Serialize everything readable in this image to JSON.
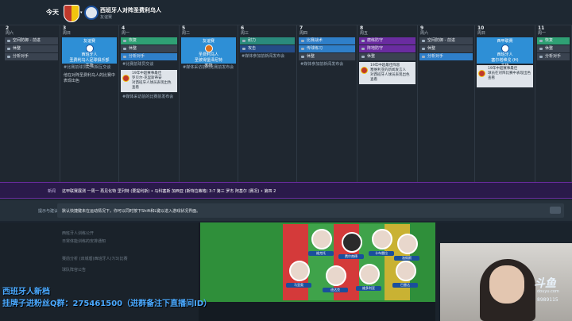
{
  "header": {
    "today": "今天",
    "match_title": "西班牙人对阵圣费利乌人",
    "match_subtitle": "友谊赛"
  },
  "calendar": {
    "days": [
      {
        "num": "2",
        "weekday": "周六",
        "items": [
          {
            "type": "bar",
            "style": "gray",
            "label": "空间防御 - 前进"
          },
          {
            "type": "bar",
            "style": "gray",
            "label": "休整"
          },
          {
            "type": "bar",
            "style": "gray",
            "label": "分析对手"
          }
        ]
      },
      {
        "num": "3",
        "weekday": "周日",
        "items": [
          {
            "type": "match",
            "style": "home",
            "lines": [
              "友谊赛",
              "西班牙人",
              "圣费利乌人足球俱乐部",
              "主场"
            ]
          },
          {
            "type": "note",
            "label": "#比赛前球员之间相互交谈"
          },
          {
            "type": "note",
            "label": "他在对阵圣费利乌人的比赛中表现出色",
            "light": true
          }
        ]
      },
      {
        "num": "4",
        "weekday": "周一",
        "items": [
          {
            "type": "bar",
            "style": "green",
            "label": "恢复"
          },
          {
            "type": "bar",
            "style": "gray",
            "label": "休整"
          },
          {
            "type": "bar",
            "style": "blue",
            "label": "分析对手"
          },
          {
            "type": "note",
            "label": "#比赛前球员交谈"
          },
          {
            "type": "event",
            "lines": [
              "19年中超赛事最佳",
              "罗贝尔-克里斯蒂安",
              "对西班牙人球员表现出色",
              "查看"
            ]
          },
          {
            "type": "note",
            "label": "#媒体采访前的比赛前发布会"
          }
        ]
      },
      {
        "num": "5",
        "weekday": "周二",
        "items": [
          {
            "type": "match",
            "style": "away",
            "lines": [
              "友谊赛",
              "圣费利乌人",
              "圣彼得堡泽尼特",
              "客场"
            ]
          },
          {
            "type": "note",
            "label": "#媒体采访前的比赛前发布会"
          }
        ]
      },
      {
        "num": "6",
        "weekday": "周三",
        "items": [
          {
            "type": "bar",
            "style": "teal",
            "label": "耐力"
          },
          {
            "type": "bar",
            "style": "dblue",
            "label": "攻击"
          },
          {
            "type": "note",
            "label": "#媒体参加前新闻发布会"
          }
        ]
      },
      {
        "num": "7",
        "weekday": "周四",
        "items": [
          {
            "type": "bar",
            "style": "blue",
            "label": "比赛战术"
          },
          {
            "type": "bar",
            "style": "blue",
            "label": "传球练习"
          },
          {
            "type": "bar",
            "style": "gray",
            "label": "休整"
          },
          {
            "type": "note",
            "label": "#媒体参加前新闻发布会"
          }
        ]
      },
      {
        "num": "8",
        "weekday": "周五",
        "items": [
          {
            "type": "bar",
            "style": "purple",
            "label": "磨练防守"
          },
          {
            "type": "bar",
            "style": "purple",
            "label": "阵地防守"
          },
          {
            "type": "bar",
            "style": "gray",
            "label": "休整"
          },
          {
            "type": "event",
            "lines": [
              "19年中超最佳阵容",
              "塞维利亚的新闻发言人",
              "对西班牙人球员表现出色",
              "查看"
            ]
          }
        ]
      },
      {
        "num": "9",
        "weekday": "周六",
        "items": [
          {
            "type": "bar",
            "style": "gray",
            "label": "空间防御 - 前进"
          },
          {
            "type": "bar",
            "style": "gray",
            "label": "休整"
          },
          {
            "type": "bar",
            "style": "blue",
            "label": "分析对手"
          }
        ]
      },
      {
        "num": "10",
        "weekday": "周日",
        "items": [
          {
            "type": "match",
            "style": "home",
            "lines": [
              "西甲联赛",
              "西班牙人",
              "塞尔塔维戈 (H)",
              "主场"
            ]
          },
          {
            "type": "event",
            "lines": [
              "19年中超赛事最佳",
              "球员在对阵比赛中表现出色",
              "查看"
            ]
          }
        ]
      },
      {
        "num": "11",
        "weekday": "周一",
        "items": [
          {
            "type": "bar",
            "style": "green",
            "label": "恢复"
          },
          {
            "type": "bar",
            "style": "gray",
            "label": "休整"
          },
          {
            "type": "bar",
            "style": "gray",
            "label": "分析对手"
          }
        ]
      }
    ]
  },
  "banner": {
    "label": "新闻",
    "text": "这甲联赛展测 一周一 再见化特 里列特 (要提利斯) • 马科塞斯 加西亚 (斯特拉蒂格) 3:7 第三 罗杰 阿基尔 (赛况) • 第四 2"
  },
  "tip": {
    "label": "提示与建议",
    "text": "默认快捷键未在运动情况下，你可以同时按下Shift和L键以进入游戏状况界面。"
  },
  "lists": {
    "left_rows": [
      "西班牙人训练公开",
      "日常体能训练的安排通知",
      "赛前分析 (双城盾)西班牙人(7/3)比赛",
      "球队阵容公告"
    ]
  },
  "formation": {
    "players": [
      {
        "name": "维克托"
      },
      {
        "name": "费尔南德"
      },
      {
        "name": "卡布雷拉"
      },
      {
        "name": "洛佩斯"
      },
      {
        "name": "马里奥"
      },
      {
        "name": "迪达克"
      },
      {
        "name": "维多利亚"
      },
      {
        "name": "巴雷达"
      }
    ]
  },
  "stream": {
    "overlay_line1": "西班牙人新档",
    "overlay_line2": "挂牌子进粉丝Q群：275461500（进群备注下直播间ID）",
    "platform_logo": "斗鱼",
    "platform_sub": "douyu.com",
    "room_id": "8989115"
  }
}
